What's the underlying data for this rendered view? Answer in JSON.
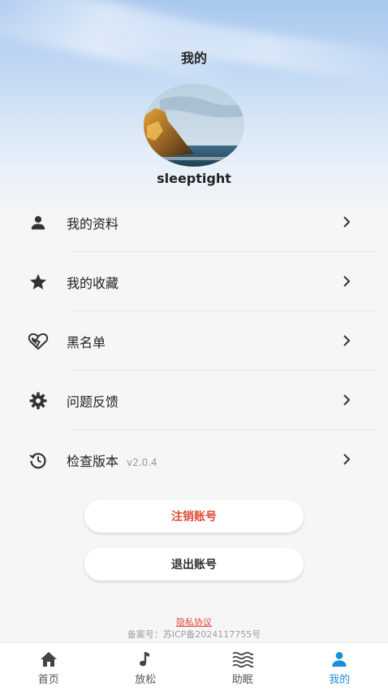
{
  "header": {
    "title": "我的"
  },
  "profile": {
    "username": "sleeptight"
  },
  "menu": {
    "items": [
      {
        "label": "我的资料",
        "icon": "person-icon"
      },
      {
        "label": "我的收藏",
        "icon": "star-icon"
      },
      {
        "label": "黑名单",
        "icon": "broken-heart-icon"
      },
      {
        "label": "问题反馈",
        "icon": "gear-icon"
      },
      {
        "label": "检查版本",
        "icon": "history-icon",
        "version": "v2.0.4"
      }
    ]
  },
  "actions": {
    "cancel_account": "注销账号",
    "logout": "退出账号"
  },
  "footer": {
    "privacy": "隐私协议",
    "icp": "备案号：苏ICP备2024117755号"
  },
  "tabbar": {
    "tabs": [
      {
        "label": "首页",
        "icon": "home-icon"
      },
      {
        "label": "放松",
        "icon": "music-note-icon"
      },
      {
        "label": "助眠",
        "icon": "waves-icon"
      },
      {
        "label": "我的",
        "icon": "person-icon",
        "active": true
      }
    ]
  },
  "colors": {
    "accent": "#1a8fd8",
    "danger": "#e24a3b"
  }
}
